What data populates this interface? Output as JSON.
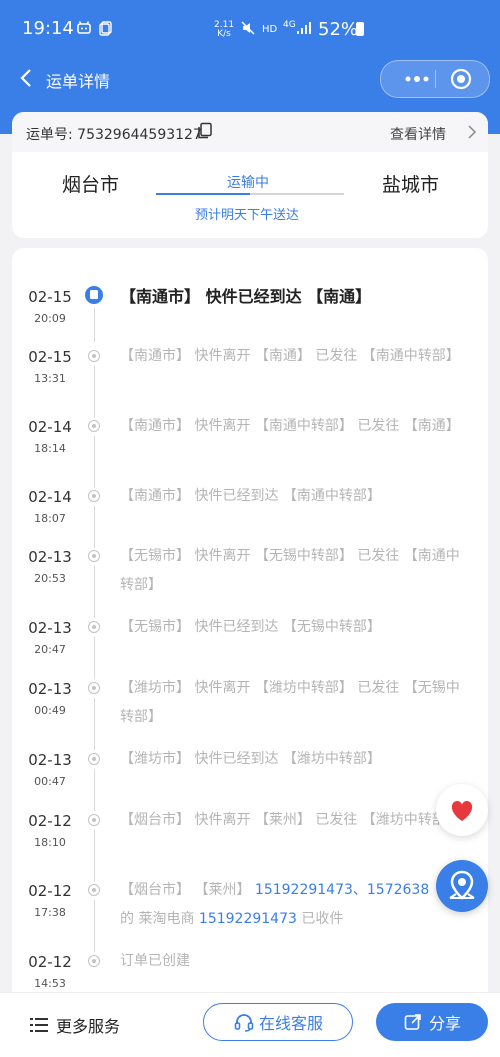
{
  "status_bar": {
    "time": "19:14",
    "net_speed_value": "2.11",
    "net_speed_unit": "K/s",
    "hd": "HD",
    "signal": "4G",
    "battery": "52%"
  },
  "nav": {
    "title": "运单详情"
  },
  "summary": {
    "waybill_label": "运单号:",
    "waybill_number": "75329644593127",
    "detail_link": "查看详情",
    "from_city": "烟台市",
    "to_city": "盐城市",
    "status": "运输中",
    "progress": 0.5,
    "eta": "预计明天下午送达"
  },
  "events": [
    {
      "date": "02-15",
      "time": "20:09",
      "text": "【南通市】 快件已经到达 【南通】",
      "active": true
    },
    {
      "date": "02-15",
      "time": "13:31",
      "text": "【南通市】 快件离开 【南通】 已发往 【南通中转部】"
    },
    {
      "date": "02-14",
      "time": "18:14",
      "text": "【南通市】 快件离开 【南通中转部】 已发往 【南通】"
    },
    {
      "date": "02-14",
      "time": "18:07",
      "text": "【南通市】 快件已经到达 【南通中转部】"
    },
    {
      "date": "02-13",
      "time": "20:53",
      "text": "【无锡市】 快件离开 【无锡中转部】 已发往 【南通中转部】"
    },
    {
      "date": "02-13",
      "time": "20:47",
      "text": "【无锡市】 快件已经到达 【无锡中转部】"
    },
    {
      "date": "02-13",
      "time": "00:49",
      "text": "【潍坊市】 快件离开 【潍坊中转部】 已发往 【无锡中转部】"
    },
    {
      "date": "02-13",
      "time": "00:47",
      "text": "【潍坊市】 快件已经到达 【潍坊中转部】"
    },
    {
      "date": "02-12",
      "time": "18:10",
      "text": "【烟台市】 快件离开 【莱州】 已发往 【潍坊中转部】"
    },
    {
      "date": "02-12",
      "time": "17:38",
      "text_before": "【烟台市】 【莱州】 ",
      "phones": "15192291473、1572638",
      "text_mid": "的 莱淘电商 ",
      "phone2": "15192291473",
      "text_after": " 已收件"
    },
    {
      "date": "02-12",
      "time": "14:53",
      "text": "订单已创建"
    }
  ],
  "bottom": {
    "more_services": "更多服务",
    "customer_service": "在线客服",
    "share": "分享"
  },
  "colors": {
    "primary": "#3a7ee8",
    "heart": "#e8383d"
  }
}
